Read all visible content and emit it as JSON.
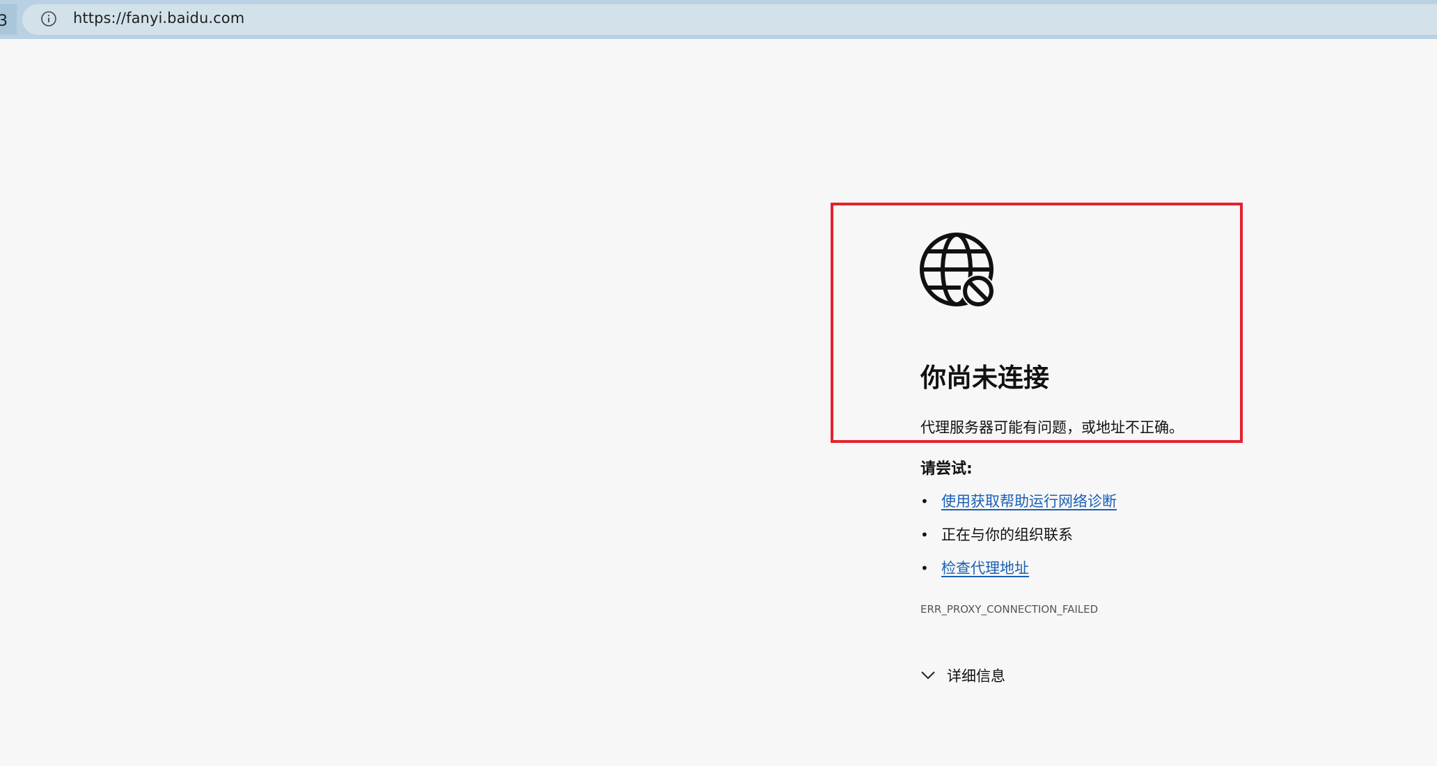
{
  "browser": {
    "url": "https://fanyi.baidu.com",
    "edge_glyph": "3",
    "info_icon": "info-circle-icon"
  },
  "error_page": {
    "icon": "globe-blocked-icon",
    "title": "你尚未连接",
    "description": "代理服务器可能有问题，或地址不正确。",
    "try_heading": "请尝试:",
    "suggestions": [
      {
        "text": "使用获取帮助运行网络诊断",
        "link": true
      },
      {
        "text": "正在与你的组织联系",
        "link": false
      },
      {
        "text": "检查代理地址",
        "link": true
      }
    ],
    "error_code": "ERR_PROXY_CONNECTION_FAILED",
    "details_label": "详细信息"
  },
  "colors": {
    "highlight_border": "#e5222c",
    "link": "#1a5fb4",
    "toolbar": "#b9d1e2",
    "address_bar": "#d2e1ea",
    "page_background": "#f7f7f7"
  }
}
